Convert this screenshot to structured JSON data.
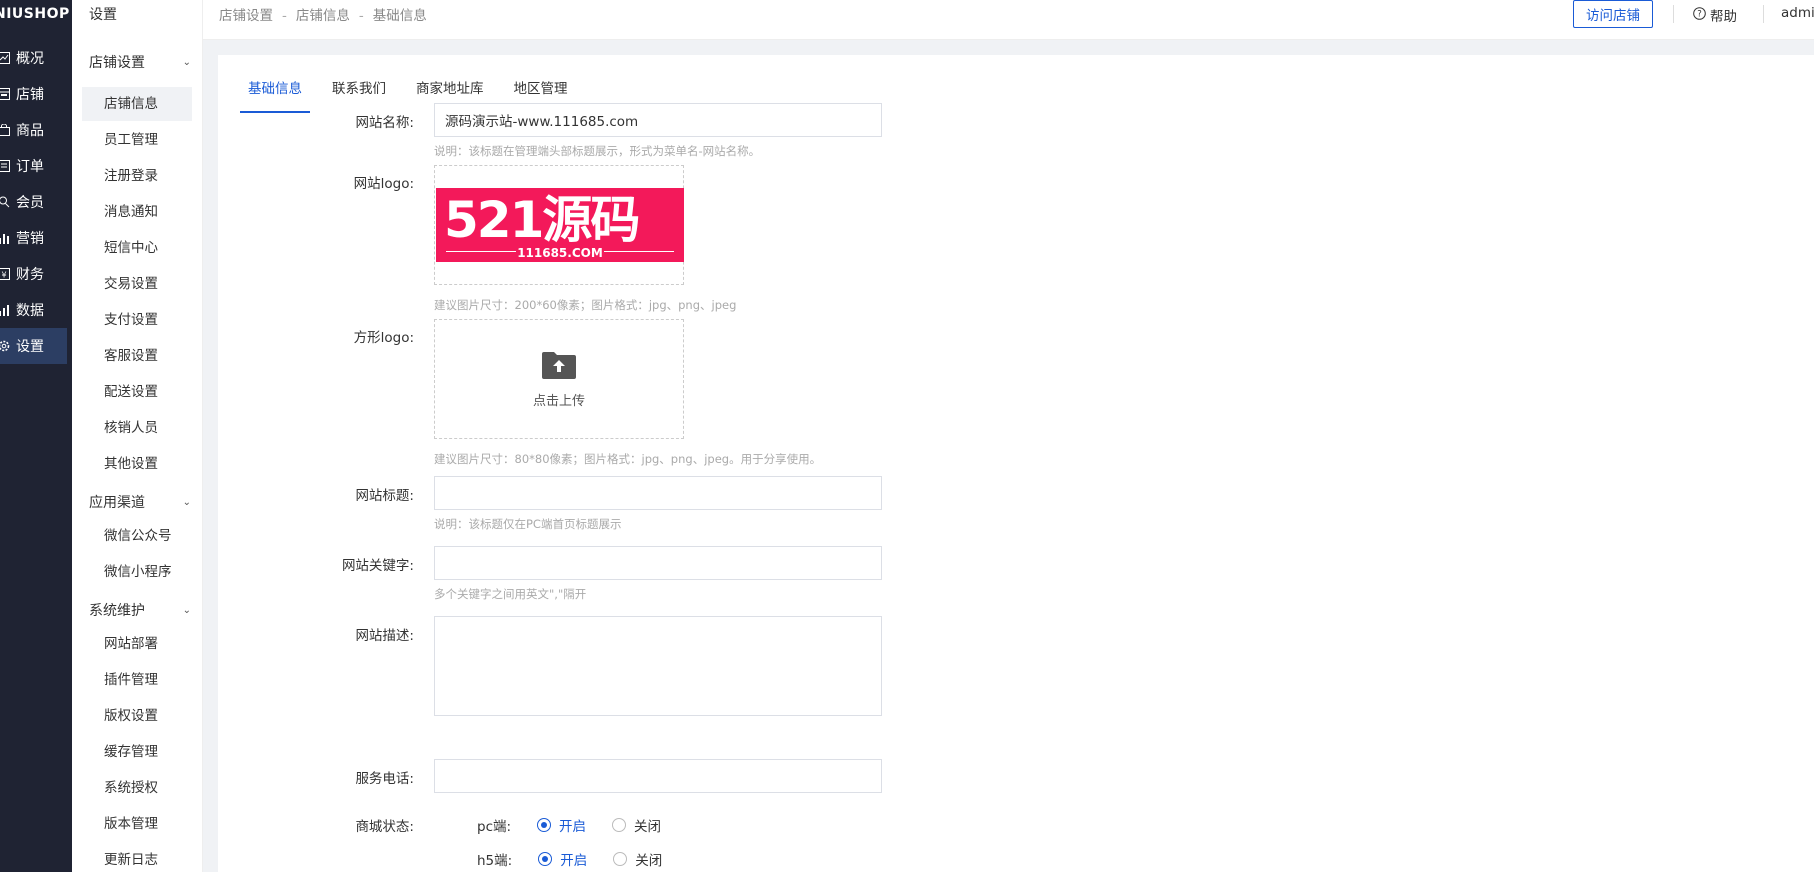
{
  "brand": "NIUSHOP",
  "rail": [
    {
      "label": "概况",
      "icon": "chart-icon"
    },
    {
      "label": "店铺",
      "icon": "store-icon"
    },
    {
      "label": "商品",
      "icon": "bag-icon"
    },
    {
      "label": "订单",
      "icon": "order-icon"
    },
    {
      "label": "会员",
      "icon": "user-icon"
    },
    {
      "label": "营销",
      "icon": "bar-icon"
    },
    {
      "label": "财务",
      "icon": "finance-icon"
    },
    {
      "label": "数据",
      "icon": "data-icon"
    },
    {
      "label": "设置",
      "icon": "gear-icon"
    }
  ],
  "sidebar": {
    "title": "设置",
    "groups": [
      {
        "label": "店铺设置",
        "items": [
          "店铺信息",
          "员工管理",
          "注册登录",
          "消息通知",
          "短信中心",
          "交易设置",
          "支付设置",
          "客服设置",
          "配送设置",
          "核销人员",
          "其他设置"
        ]
      },
      {
        "label": "应用渠道",
        "items": [
          "微信公众号",
          "微信小程序"
        ]
      },
      {
        "label": "系统维护",
        "items": [
          "网站部署",
          "插件管理",
          "版权设置",
          "缓存管理",
          "系统授权",
          "版本管理",
          "更新日志"
        ]
      }
    ]
  },
  "breadcrumb": [
    "店铺设置",
    "店铺信息",
    "基础信息"
  ],
  "breadcrumb_sep": "-",
  "topbar": {
    "visit_label": "访问店铺",
    "help_label": "帮助",
    "user": "admin"
  },
  "tabs": [
    "基础信息",
    "联系我们",
    "商家地址库",
    "地区管理"
  ],
  "form": {
    "site_name_label": "网站名称:",
    "site_name_value": "源码演示站-www.111685.com",
    "site_name_hint": "说明：该标题在管理端头部标题展示，形式为菜单名-网站名称。",
    "logo_label": "网站logo:",
    "logo_text": "521源码",
    "logo_sub": "111685.COM",
    "logo_hint": "建议图片尺寸：200*60像素；图片格式：jpg、png、jpeg",
    "square_logo_label": "方形logo:",
    "upload_text": "点击上传",
    "square_logo_hint": "建议图片尺寸：80*80像素；图片格式：jpg、png、jpeg。用于分享使用。",
    "site_title_label": "网站标题:",
    "site_title_hint": "说明：该标题仅在PC端首页标题展示",
    "keywords_label": "网站关键字:",
    "keywords_hint": "多个关键字之间用英文\",\"隔开",
    "desc_label": "网站描述:",
    "phone_label": "服务电话:",
    "status_label": "商城状态:",
    "pc_label": "pc端:",
    "h5_label": "h5端:",
    "on_label": "开启",
    "off_label": "关闭"
  },
  "colors": {
    "accent": "#1a5bd6",
    "rail_bg": "#1f2333",
    "logo_bg": "#f3195a"
  }
}
